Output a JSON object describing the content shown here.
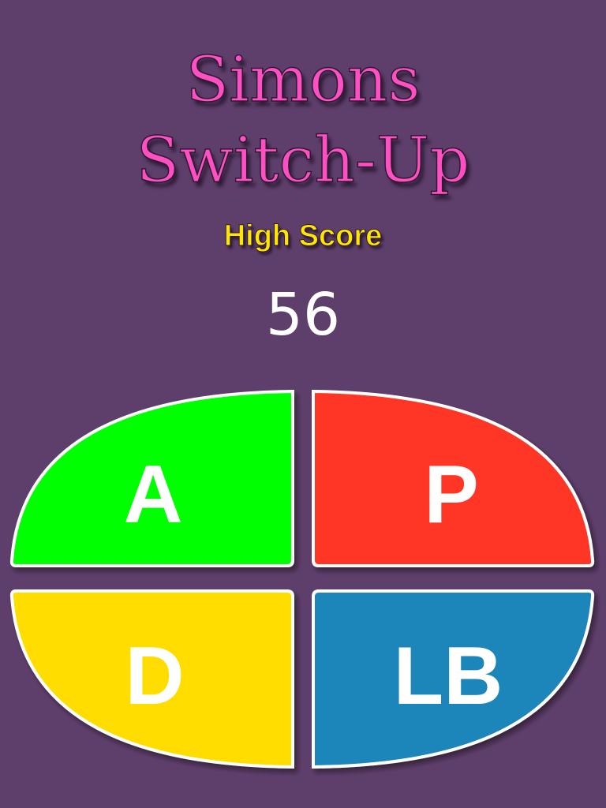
{
  "title": {
    "line1": "Simons",
    "line2": "Switch-Up"
  },
  "high_score": {
    "label": "High Score",
    "value": "56"
  },
  "pads": [
    {
      "id": "top-left",
      "label": "A",
      "color": "#00ff00"
    },
    {
      "id": "top-right",
      "label": "P",
      "color": "#ff3425"
    },
    {
      "id": "bottom-left",
      "label": "D",
      "color": "#ffdd00"
    },
    {
      "id": "bottom-right",
      "label": "LB",
      "color": "#1f86ba"
    }
  ],
  "colors": {
    "background": "#5e3f6b",
    "title": "#ff4fc3",
    "high_score_label": "#ffe600",
    "pad_border": "#ffffff"
  }
}
